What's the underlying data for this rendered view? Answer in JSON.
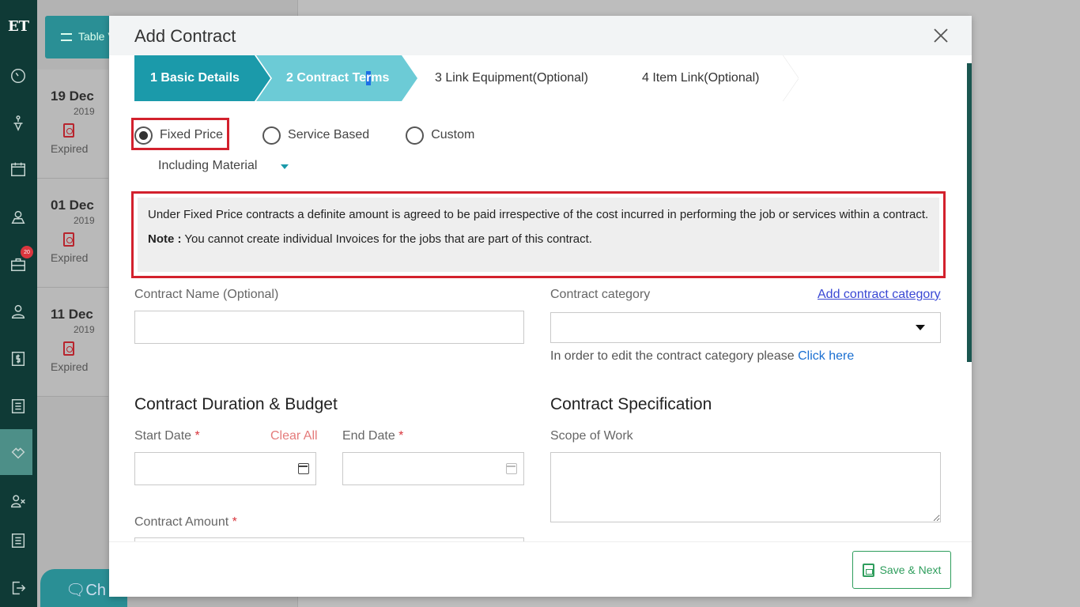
{
  "sidebar": {
    "logo": "ET",
    "badge_count": "20",
    "icons": [
      "dashboard-icon",
      "jobs-icon",
      "calendar-icon",
      "map-icon",
      "toolbox-icon",
      "user-icon",
      "invoice-icon",
      "list-icon",
      "contract-icon",
      "team-icon",
      "settings-icon",
      "logout-icon"
    ]
  },
  "background": {
    "table_view_label": "Table V",
    "chat_label": "Ch",
    "dates": [
      {
        "day": "19 Dec",
        "year": "2019",
        "status": "Expired"
      },
      {
        "day": "01 Dec",
        "year": "2019",
        "status": "Expired"
      },
      {
        "day": "11 Dec",
        "year": "2019",
        "status": "Expired"
      }
    ]
  },
  "modal": {
    "title": "Add Contract",
    "steps": [
      {
        "label": "1 Basic Details"
      },
      {
        "label_before": "2 Contract Te",
        "label_highlight": "r",
        "label_after": "ms"
      },
      {
        "label": "3 Link Equipment ",
        "suffix": "(Optional)"
      },
      {
        "label": "4 Item Link(Optional)"
      }
    ],
    "contract_types": {
      "fixed": "Fixed Price",
      "service": "Service Based",
      "custom": "Custom",
      "selected": "Fixed Price"
    },
    "material_option": "Including Material",
    "info": {
      "text": "Under Fixed Price contracts a definite amount is agreed to be paid irrespective of the cost incurred in performing the job or services within a contract.",
      "note_label": "Note :",
      "note_text": " You cannot create individual Invoices for the jobs that are part of this contract."
    },
    "form": {
      "contract_name_label": "Contract Name (Optional)",
      "contract_name_value": "",
      "category_label": "Contract category",
      "add_category_link": "Add contract category",
      "category_value": "",
      "category_hint": "In order to edit the contract category please ",
      "category_hint_link": "Click here",
      "duration_title": "Contract Duration & Budget",
      "start_date_label": "Start Date ",
      "end_date_label": "End Date ",
      "required_mark": "*",
      "clear_all": "Clear All",
      "amount_label": "Contract Amount ",
      "spec_title": "Contract Specification",
      "scope_label": "Scope of Work"
    },
    "save_next_label": "Save & Next"
  }
}
